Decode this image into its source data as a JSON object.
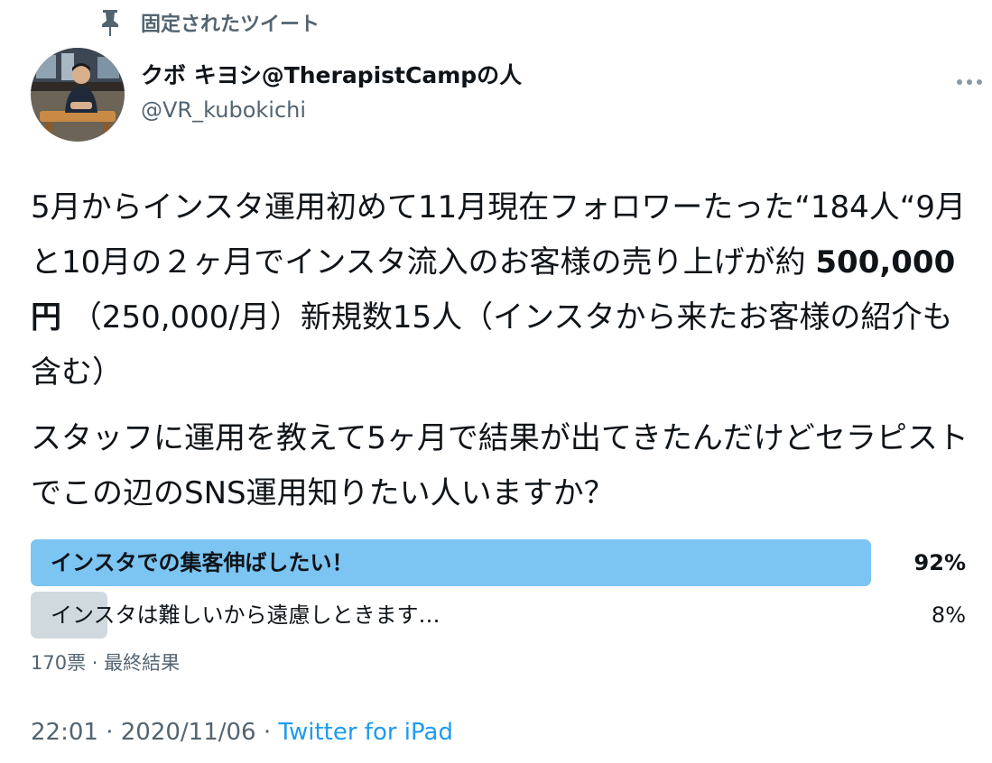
{
  "pinned": {
    "label": "固定されたツイート",
    "icon": "pin-icon"
  },
  "user": {
    "display_name": "クボ キヨシ@TherapistCampの人",
    "handle": "@VR_kubokichi",
    "avatar_icon": "avatar-photo"
  },
  "more_icon": "more-horizontal-icon",
  "tweet": {
    "para1_part1": "5月からインスタ運用初めて11月現在フォロワーたった“184人“9月と10月の２ヶ月でインスタ流入のお客様の売り上げが約 ",
    "para1_amount": "500,000円",
    "para1_part2": " （250,000/月）新規数15人（インスタから来たお客様の紹介も含む）",
    "para2": "スタッフに運用を教えて5ヶ月で結果が出てきたんだけどセラピストでこの辺のSNS運用知りたい人いますか？"
  },
  "poll": {
    "options": [
      {
        "label": "インスタでの集客伸ばしたい！",
        "percent_text": "92%",
        "percent": 92,
        "winner": true
      },
      {
        "label": "インスタは難しいから遠慮しときます…",
        "percent_text": "8%",
        "percent": 8,
        "winner": false
      }
    ],
    "meta": "170票 · 最終結果"
  },
  "footer": {
    "time": "22:01",
    "separator": " · ",
    "date": "2020/11/06",
    "source": "Twitter for iPad"
  },
  "colors": {
    "winner_bar": "#7cc4f2",
    "loser_bar": "#cfd9de",
    "secondary_text": "#536471",
    "link": "#1d9bf0"
  }
}
